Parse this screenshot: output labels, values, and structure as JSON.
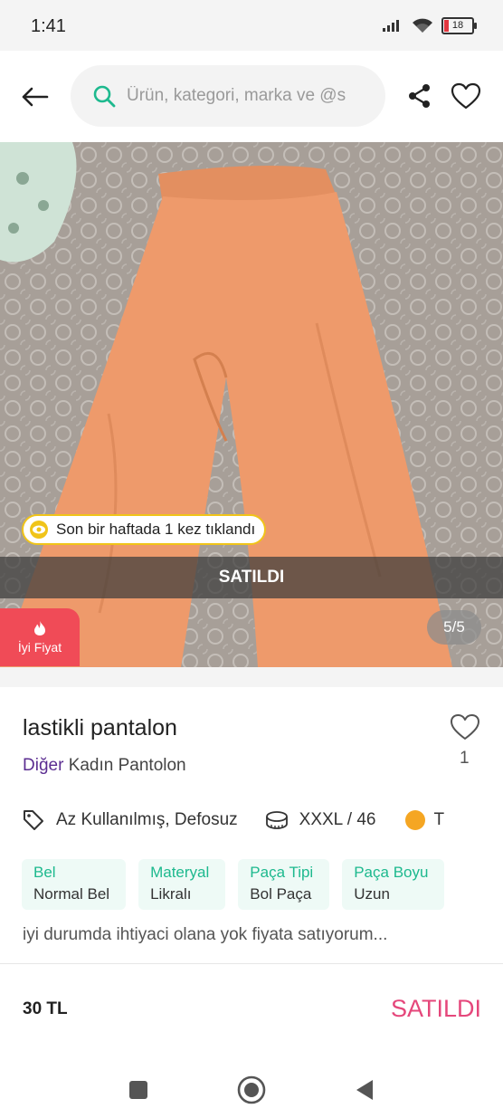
{
  "status_bar": {
    "time": "1:41",
    "battery_level": "18",
    "icons": [
      "signal-icon",
      "wifi-icon",
      "battery-icon"
    ]
  },
  "header": {
    "search_placeholder": "Ürün, kategori, marka ve @s",
    "icons": [
      "back-arrow-icon",
      "search-icon",
      "share-icon",
      "heart-icon"
    ]
  },
  "gallery": {
    "view_notice": "Son bir haftada 1 kez tıklandı",
    "sold_banner": "SATILDI",
    "price_badge_label": "İyi Fiyat",
    "counter": "5/5"
  },
  "product": {
    "title": "lastikli pantalon",
    "brand": "Diğer",
    "category": "Kadın Pantolon",
    "like_count": "1",
    "condition": "Az Kullanılmış, Defosuz",
    "size": "XXXL / 46",
    "color_initial": "T",
    "color_hex": "#f5a623",
    "specs": [
      {
        "key": "Bel",
        "value": "Normal Bel"
      },
      {
        "key": "Materyal",
        "value": "Likralı"
      },
      {
        "key": "Paça Tipi",
        "value": "Bol Paça"
      },
      {
        "key": "Paça Boyu",
        "value": "Uzun"
      }
    ],
    "description": "iyi durumda ihtiyaci olana yok fiyata satıyorum..."
  },
  "footer": {
    "price": "30 TL",
    "status": "SATILDI"
  },
  "colors": {
    "accent_green": "#1db98e",
    "sold_pink": "#e5477b",
    "brand_purple": "#5b2d91",
    "badge_red": "#f04b57"
  }
}
